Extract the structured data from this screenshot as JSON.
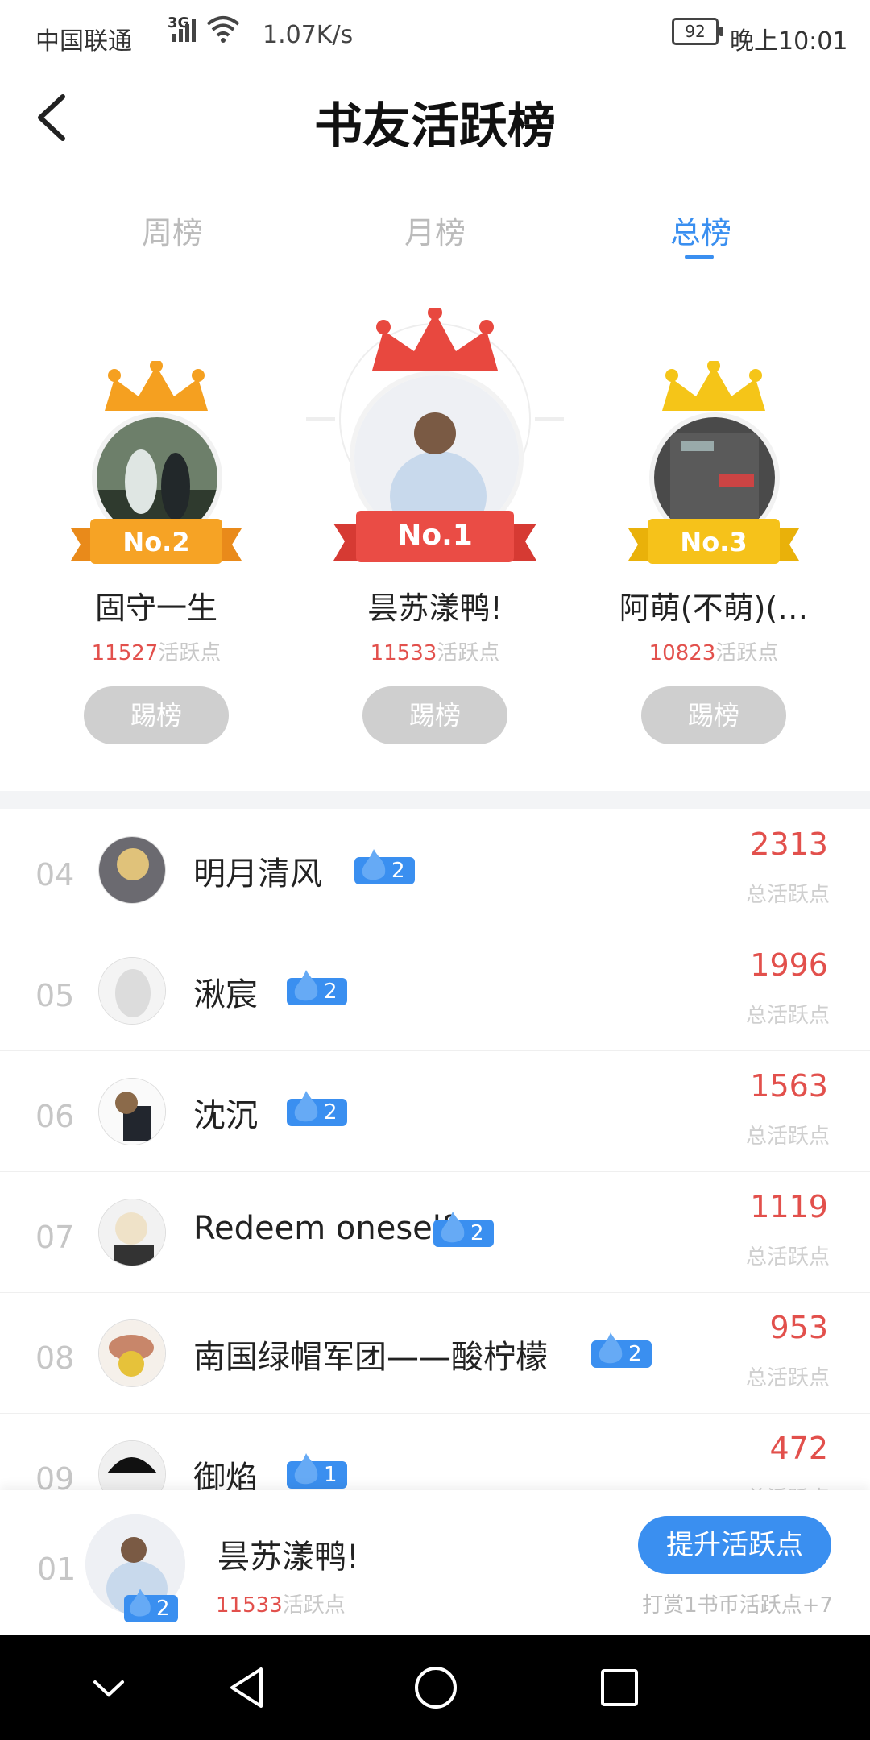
{
  "status_bar": {
    "carrier": "中国联通",
    "network": "3G",
    "speed": "1.07K/s",
    "battery": "92",
    "time": "晚上10:01"
  },
  "header": {
    "title": "书友活跃榜"
  },
  "tabs": [
    {
      "label": "周榜",
      "active": false
    },
    {
      "label": "月榜",
      "active": false
    },
    {
      "label": "总榜",
      "active": true
    }
  ],
  "podium": [
    {
      "rank_label": "No.2",
      "name": "固守一生",
      "points": "11527",
      "unit": "活跃点",
      "button": "踢榜",
      "crown_color": "#f5a020"
    },
    {
      "rank_label": "No.1",
      "name": "昙苏漾鸭!",
      "points": "11533",
      "unit": "活跃点",
      "button": "踢榜",
      "crown_color": "#e8483f"
    },
    {
      "rank_label": "No.3",
      "name": "阿萌(不萌)(…",
      "points": "10823",
      "unit": "活跃点",
      "button": "踢榜",
      "crown_color": "#f5c518"
    }
  ],
  "list": [
    {
      "rank": "04",
      "name": "明月清风",
      "level": "2",
      "points": "2313",
      "unit": "总活跃点"
    },
    {
      "rank": "05",
      "name": "湫宸",
      "level": "2",
      "points": "1996",
      "unit": "总活跃点"
    },
    {
      "rank": "06",
      "name": "沈沉",
      "level": "2",
      "points": "1563",
      "unit": "总活跃点"
    },
    {
      "rank": "07",
      "name": "Redeem oneself",
      "level": "2",
      "points": "1119",
      "unit": "总活跃点"
    },
    {
      "rank": "08",
      "name": "南国绿帽军团——酸柠檬",
      "level": "2",
      "points": "953",
      "unit": "总活跃点"
    },
    {
      "rank": "09",
      "name": "御焰",
      "level": "1",
      "points": "472",
      "unit": "总活跃点"
    }
  ],
  "my_rank": {
    "rank": "01",
    "name": "昙苏漾鸭!",
    "level": "2",
    "points": "11533",
    "unit": "活跃点",
    "boost_button": "提升活跃点",
    "tip": "打赏1书币活跃点+7"
  },
  "colors": {
    "accent": "#3a8ff0",
    "points_red": "#e2504c"
  }
}
